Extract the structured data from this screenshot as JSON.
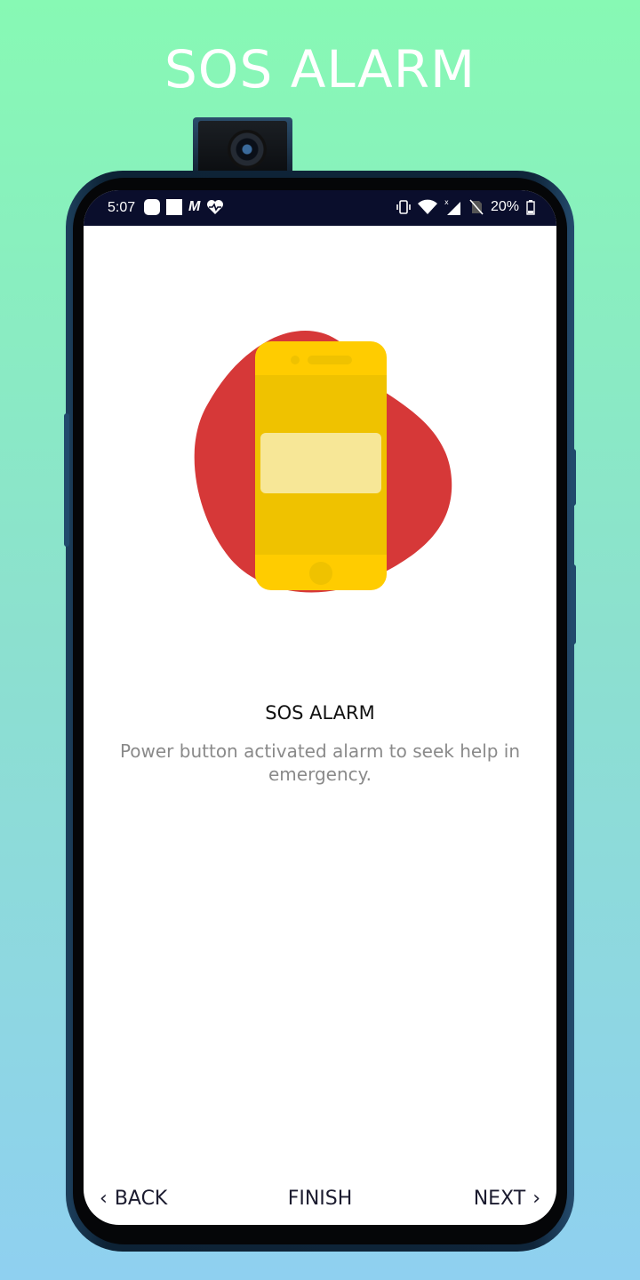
{
  "banner": {
    "title": "SOS ALARM"
  },
  "status_bar": {
    "time": "5:07",
    "battery": "20%"
  },
  "slide": {
    "title": "SOS ALARM",
    "description": "Power button activated alarm to seek help in emergency."
  },
  "nav": {
    "back_label": "BACK",
    "finish_label": "FINISH",
    "next_label": "NEXT"
  },
  "colors": {
    "blob": "#d63838",
    "phone_body": "#ffcc00",
    "phone_screen": "#efc200",
    "phone_card": "#f7e797",
    "status_bar": "#0a0e2c"
  }
}
